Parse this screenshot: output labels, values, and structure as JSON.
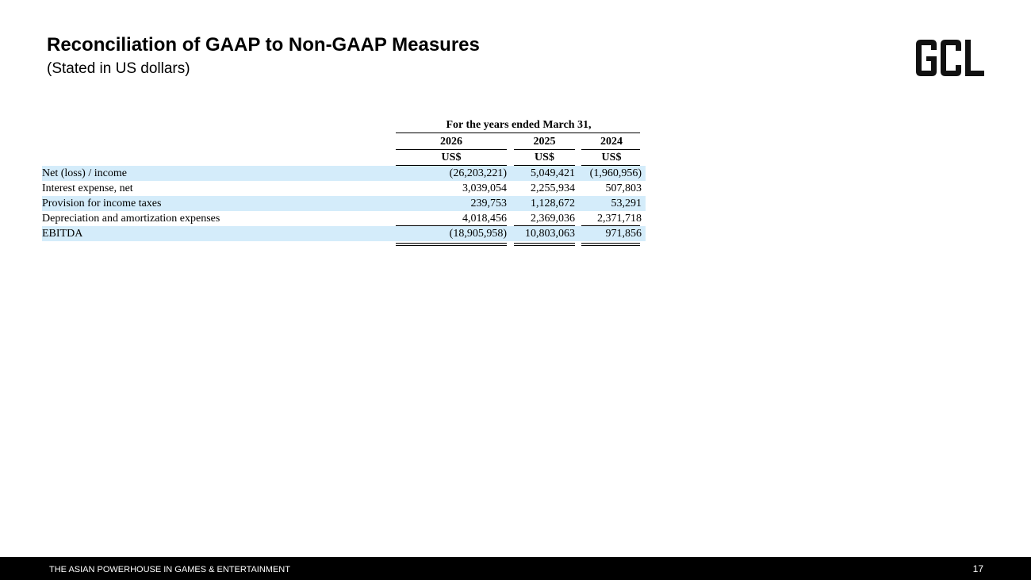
{
  "header": {
    "title": "Reconciliation of GAAP to Non-GAAP Measures",
    "subtitle": "(Stated in US dollars)",
    "logo_text": "GCL"
  },
  "table": {
    "period_header": "For the years ended March 31,",
    "years": [
      "2026",
      "2025",
      "2024"
    ],
    "currency": [
      "US$",
      "US$",
      "US$"
    ],
    "rows": [
      {
        "label": "Net (loss) / income",
        "values": [
          "(26,203,221)",
          "5,049,421",
          "(1,960,956)"
        ],
        "shaded": true
      },
      {
        "label": "Interest expense, net",
        "values": [
          "3,039,054",
          "2,255,934",
          "507,803"
        ],
        "shaded": false
      },
      {
        "label": "Provision for income taxes",
        "values": [
          "239,753",
          "1,128,672",
          "53,291"
        ],
        "shaded": true
      },
      {
        "label": "Depreciation and amortization expenses",
        "values": [
          "4,018,456",
          "2,369,036",
          "2,371,718"
        ],
        "shaded": false
      },
      {
        "label": "EBITDA",
        "values": [
          "(18,905,958)",
          "10,803,063",
          "971,856"
        ],
        "shaded": true
      }
    ]
  },
  "footer": {
    "tagline": "THE ASIAN POWERHOUSE IN GAMES & ENTERTAINMENT",
    "page_number": "17"
  },
  "colors": {
    "row_shade": "#d4ecfa",
    "footer_bg": "#000000"
  }
}
